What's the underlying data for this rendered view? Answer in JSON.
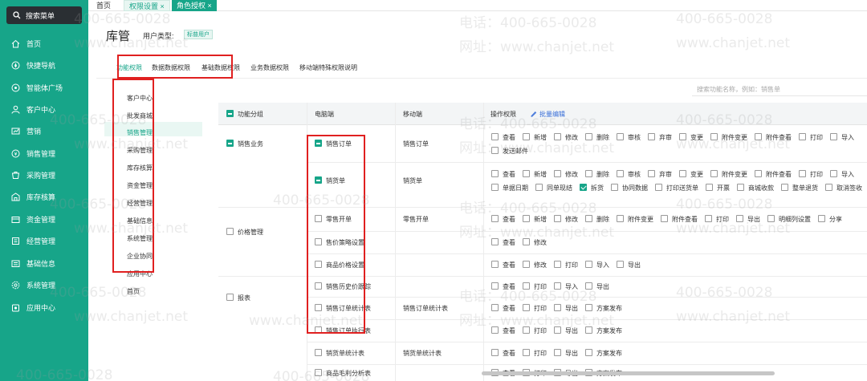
{
  "sidebar": {
    "search_label": "搜索菜单",
    "items": [
      {
        "label": "首页",
        "icon": "home-icon"
      },
      {
        "label": "快捷导航",
        "icon": "navigation-icon"
      },
      {
        "label": "智能体广场",
        "icon": "agent-icon"
      },
      {
        "label": "客户中心",
        "icon": "customer-icon"
      },
      {
        "label": "营销",
        "icon": "marketing-icon"
      },
      {
        "label": "销售管理",
        "icon": "sales-icon"
      },
      {
        "label": "采购管理",
        "icon": "purchase-icon"
      },
      {
        "label": "库存核算",
        "icon": "inventory-icon"
      },
      {
        "label": "资金管理",
        "icon": "funds-icon"
      },
      {
        "label": "经营管理",
        "icon": "operations-icon"
      },
      {
        "label": "基础信息",
        "icon": "basic-info-icon"
      },
      {
        "label": "系统管理",
        "icon": "system-icon"
      },
      {
        "label": "应用中心",
        "icon": "app-center-icon"
      }
    ]
  },
  "top_tabs": {
    "home": "首页",
    "permission_settings": "权限设置",
    "role_auth": "角色授权",
    "close_glyph": "×"
  },
  "header": {
    "title": "库管",
    "user_type_label": "用户类型:",
    "user_type_value": "标普用户"
  },
  "sub_tabs": [
    "功能权限",
    "数据数据权限",
    "基础数据权限",
    "业务数据权限",
    "移动端特殊权限说明"
  ],
  "search_placeholder": "搜索功能名称，例如：销售单",
  "categories": [
    "客户中心",
    "批发商城",
    "销售管理",
    "采购管理",
    "库存核算",
    "资金管理",
    "经营管理",
    "基础信息",
    "系统管理",
    "企业协同",
    "应用中心",
    "首页"
  ],
  "table": {
    "headers": {
      "group": "功能分组",
      "desktop": "电脑端",
      "mobile": "移动端",
      "ops": "操作权限",
      "batch_edit": "批量编辑"
    },
    "groups": [
      "销售业务",
      "价格管理",
      "报表"
    ],
    "rows": [
      {
        "desktop": "销售订单",
        "mobile": "销售订单",
        "ops": [
          [
            "查看",
            "新增",
            "修改",
            "删除",
            "审核",
            "弃审",
            "变更",
            "附件变更",
            "附件查看",
            "打印",
            "导入"
          ],
          [
            "发送邮件"
          ]
        ]
      },
      {
        "desktop": "销货单",
        "mobile": "销货单",
        "ops": [
          [
            "查看",
            "新增",
            "修改",
            "删除",
            "审核",
            "弃审",
            "变更",
            "附件变更",
            "附件查看",
            "打印",
            "导入"
          ],
          [
            "单据日期",
            "同单现结",
            "拆货",
            "协同数据",
            "打印送货单",
            "开票",
            "商城收款",
            "整单退货",
            "取消签收"
          ]
        ]
      },
      {
        "desktop": "零售开单",
        "mobile": "零售开单",
        "ops": [
          [
            "查看",
            "新增",
            "修改",
            "删除",
            "附件变更",
            "附件查看",
            "打印",
            "导出",
            "明细列设置",
            "分享"
          ]
        ]
      },
      {
        "desktop": "售价策略设置",
        "mobile": "",
        "ops": [
          [
            "查看",
            "修改"
          ]
        ]
      },
      {
        "desktop": "商品价格设置",
        "mobile": "",
        "ops": [
          [
            "查看",
            "修改",
            "打印",
            "导入",
            "导出"
          ]
        ]
      },
      {
        "desktop": "销售历史价跟踪",
        "mobile": "",
        "ops": [
          [
            "查看",
            "打印",
            "导入",
            "导出"
          ]
        ]
      },
      {
        "desktop": "销售订单统计表",
        "mobile": "销售订单统计表",
        "ops": [
          [
            "查看",
            "打印",
            "导出",
            "方案发布"
          ]
        ]
      },
      {
        "desktop": "销售订单执行表",
        "mobile": "",
        "ops": [
          [
            "查看",
            "打印",
            "导出",
            "方案发布"
          ]
        ]
      },
      {
        "desktop": "销货单统计表",
        "mobile": "销货单统计表",
        "ops": [
          [
            "查看",
            "打印",
            "导出",
            "方案发布"
          ]
        ]
      },
      {
        "desktop": "商品毛利分析表",
        "mobile": "",
        "ops": [
          [
            "查看",
            "打印",
            "导出",
            "方案发布"
          ]
        ]
      }
    ]
  },
  "watermark": {
    "phone": "电话：400-665-0028",
    "site": "网址：www.chanjet.net",
    "phone_short": "400-665-0028",
    "site_short": "www.chanjet.net"
  },
  "colors": {
    "primary": "#17a589",
    "highlight": "#e02020",
    "link": "#3a6fd8"
  }
}
